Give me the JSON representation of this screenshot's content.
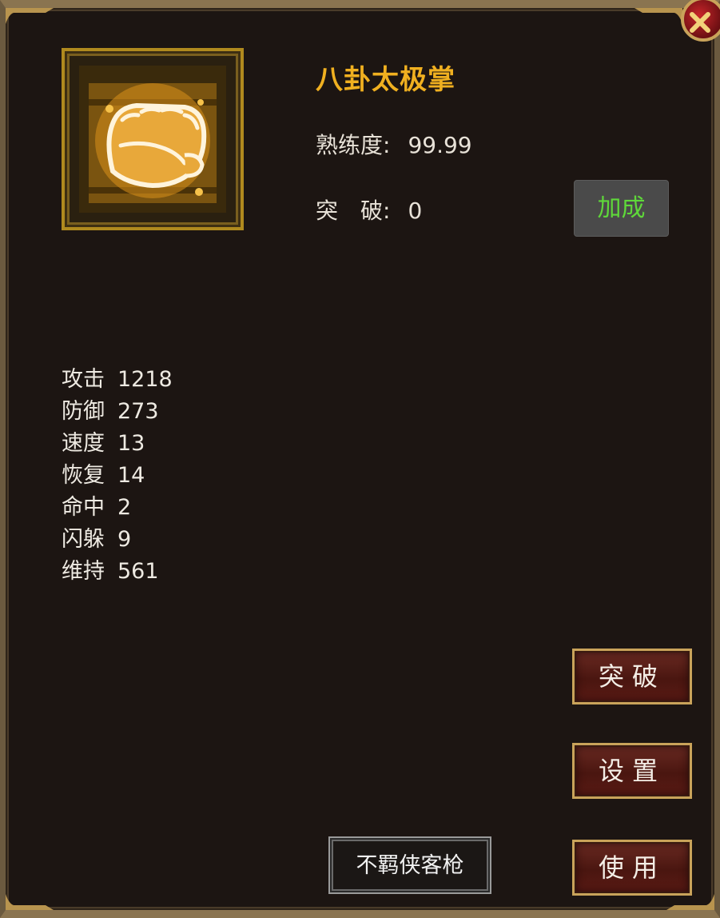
{
  "skill": {
    "name": "八卦太极掌",
    "icon": "fist-icon",
    "proficiency_label": "熟练度:",
    "proficiency_value": "99.99",
    "breakthrough_label": "突　破:",
    "breakthrough_value": "0"
  },
  "bonus_button": {
    "label": "加成"
  },
  "stats": [
    {
      "label": "攻击",
      "value": "1218"
    },
    {
      "label": "防御",
      "value": "273"
    },
    {
      "label": "速度",
      "value": "13"
    },
    {
      "label": "恢复",
      "value": "14"
    },
    {
      "label": "命中",
      "value": "2"
    },
    {
      "label": "闪躲",
      "value": "9"
    },
    {
      "label": "维持",
      "value": "561"
    }
  ],
  "actions": {
    "breakthrough": "突破",
    "setup": "设置",
    "use": "使用"
  },
  "name_plate": {
    "text": "不羁侠客枪"
  },
  "colors": {
    "skill_name": "#f0b020",
    "bonus_text": "#5fd83a",
    "panel_bg": "#1c1512",
    "border_gold": "#c9a35a"
  }
}
